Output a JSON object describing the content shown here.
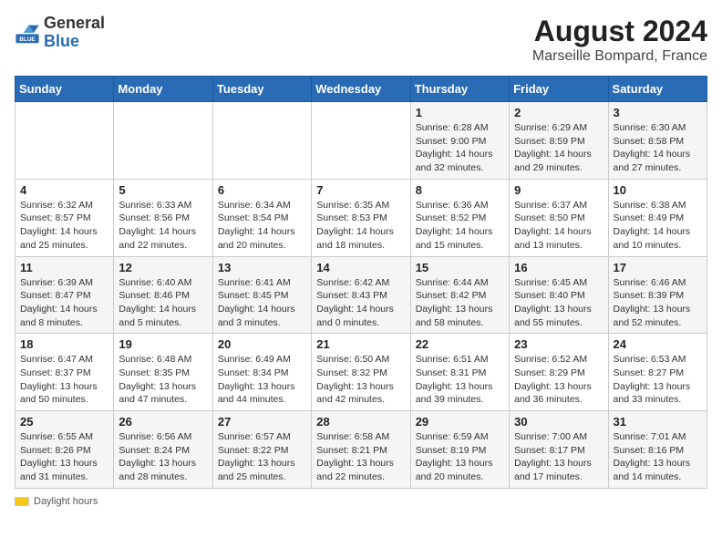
{
  "header": {
    "logo_general": "General",
    "logo_blue": "Blue",
    "month_year": "August 2024",
    "location": "Marseille Bompard, France"
  },
  "days_of_week": [
    "Sunday",
    "Monday",
    "Tuesday",
    "Wednesday",
    "Thursday",
    "Friday",
    "Saturday"
  ],
  "weeks": [
    [
      {
        "day": "",
        "info": ""
      },
      {
        "day": "",
        "info": ""
      },
      {
        "day": "",
        "info": ""
      },
      {
        "day": "",
        "info": ""
      },
      {
        "day": "1",
        "info": "Sunrise: 6:28 AM\nSunset: 9:00 PM\nDaylight: 14 hours\nand 32 minutes."
      },
      {
        "day": "2",
        "info": "Sunrise: 6:29 AM\nSunset: 8:59 PM\nDaylight: 14 hours\nand 29 minutes."
      },
      {
        "day": "3",
        "info": "Sunrise: 6:30 AM\nSunset: 8:58 PM\nDaylight: 14 hours\nand 27 minutes."
      }
    ],
    [
      {
        "day": "4",
        "info": "Sunrise: 6:32 AM\nSunset: 8:57 PM\nDaylight: 14 hours\nand 25 minutes."
      },
      {
        "day": "5",
        "info": "Sunrise: 6:33 AM\nSunset: 8:56 PM\nDaylight: 14 hours\nand 22 minutes."
      },
      {
        "day": "6",
        "info": "Sunrise: 6:34 AM\nSunset: 8:54 PM\nDaylight: 14 hours\nand 20 minutes."
      },
      {
        "day": "7",
        "info": "Sunrise: 6:35 AM\nSunset: 8:53 PM\nDaylight: 14 hours\nand 18 minutes."
      },
      {
        "day": "8",
        "info": "Sunrise: 6:36 AM\nSunset: 8:52 PM\nDaylight: 14 hours\nand 15 minutes."
      },
      {
        "day": "9",
        "info": "Sunrise: 6:37 AM\nSunset: 8:50 PM\nDaylight: 14 hours\nand 13 minutes."
      },
      {
        "day": "10",
        "info": "Sunrise: 6:38 AM\nSunset: 8:49 PM\nDaylight: 14 hours\nand 10 minutes."
      }
    ],
    [
      {
        "day": "11",
        "info": "Sunrise: 6:39 AM\nSunset: 8:47 PM\nDaylight: 14 hours\nand 8 minutes."
      },
      {
        "day": "12",
        "info": "Sunrise: 6:40 AM\nSunset: 8:46 PM\nDaylight: 14 hours\nand 5 minutes."
      },
      {
        "day": "13",
        "info": "Sunrise: 6:41 AM\nSunset: 8:45 PM\nDaylight: 14 hours\nand 3 minutes."
      },
      {
        "day": "14",
        "info": "Sunrise: 6:42 AM\nSunset: 8:43 PM\nDaylight: 14 hours\nand 0 minutes."
      },
      {
        "day": "15",
        "info": "Sunrise: 6:44 AM\nSunset: 8:42 PM\nDaylight: 13 hours\nand 58 minutes."
      },
      {
        "day": "16",
        "info": "Sunrise: 6:45 AM\nSunset: 8:40 PM\nDaylight: 13 hours\nand 55 minutes."
      },
      {
        "day": "17",
        "info": "Sunrise: 6:46 AM\nSunset: 8:39 PM\nDaylight: 13 hours\nand 52 minutes."
      }
    ],
    [
      {
        "day": "18",
        "info": "Sunrise: 6:47 AM\nSunset: 8:37 PM\nDaylight: 13 hours\nand 50 minutes."
      },
      {
        "day": "19",
        "info": "Sunrise: 6:48 AM\nSunset: 8:35 PM\nDaylight: 13 hours\nand 47 minutes."
      },
      {
        "day": "20",
        "info": "Sunrise: 6:49 AM\nSunset: 8:34 PM\nDaylight: 13 hours\nand 44 minutes."
      },
      {
        "day": "21",
        "info": "Sunrise: 6:50 AM\nSunset: 8:32 PM\nDaylight: 13 hours\nand 42 minutes."
      },
      {
        "day": "22",
        "info": "Sunrise: 6:51 AM\nSunset: 8:31 PM\nDaylight: 13 hours\nand 39 minutes."
      },
      {
        "day": "23",
        "info": "Sunrise: 6:52 AM\nSunset: 8:29 PM\nDaylight: 13 hours\nand 36 minutes."
      },
      {
        "day": "24",
        "info": "Sunrise: 6:53 AM\nSunset: 8:27 PM\nDaylight: 13 hours\nand 33 minutes."
      }
    ],
    [
      {
        "day": "25",
        "info": "Sunrise: 6:55 AM\nSunset: 8:26 PM\nDaylight: 13 hours\nand 31 minutes."
      },
      {
        "day": "26",
        "info": "Sunrise: 6:56 AM\nSunset: 8:24 PM\nDaylight: 13 hours\nand 28 minutes."
      },
      {
        "day": "27",
        "info": "Sunrise: 6:57 AM\nSunset: 8:22 PM\nDaylight: 13 hours\nand 25 minutes."
      },
      {
        "day": "28",
        "info": "Sunrise: 6:58 AM\nSunset: 8:21 PM\nDaylight: 13 hours\nand 22 minutes."
      },
      {
        "day": "29",
        "info": "Sunrise: 6:59 AM\nSunset: 8:19 PM\nDaylight: 13 hours\nand 20 minutes."
      },
      {
        "day": "30",
        "info": "Sunrise: 7:00 AM\nSunset: 8:17 PM\nDaylight: 13 hours\nand 17 minutes."
      },
      {
        "day": "31",
        "info": "Sunrise: 7:01 AM\nSunset: 8:16 PM\nDaylight: 13 hours\nand 14 minutes."
      }
    ]
  ],
  "footer": {
    "legend_label": "Daylight hours"
  }
}
